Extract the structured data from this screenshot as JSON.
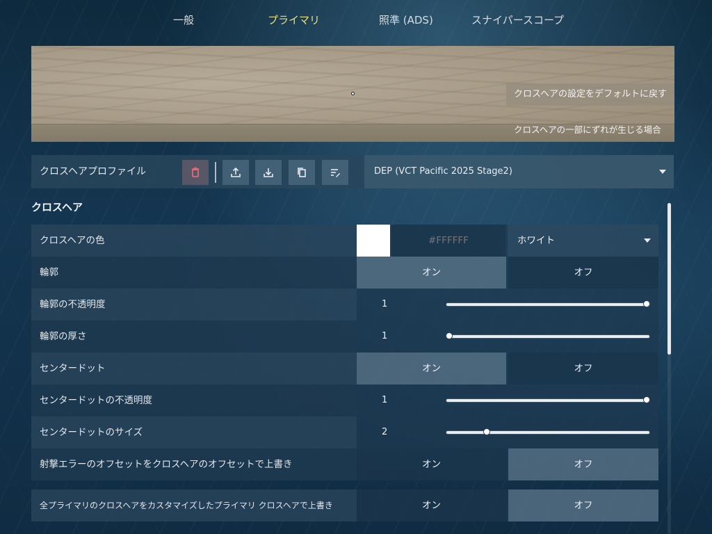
{
  "tabs": [
    {
      "label": "一般",
      "active": false
    },
    {
      "label": "プライマリ",
      "active": true
    },
    {
      "label": "照準 (ADS)",
      "active": false
    },
    {
      "label": "スナイパースコープ",
      "active": false
    }
  ],
  "preview": {
    "reset_button": "クロスヘアの設定をデフォルトに戻す",
    "misalignment_link": "クロスヘアの一部にずれが生じる場合"
  },
  "profile": {
    "label": "クロスヘアプロファイル",
    "buttons": [
      "delete-icon",
      "export-icon",
      "import-icon",
      "copy-icon",
      "rename-icon"
    ],
    "selected": "DEP (VCT Pacific 2025 Stage2)"
  },
  "section": {
    "title": "クロスヘア"
  },
  "settings": {
    "color": {
      "label": "クロスヘアの色",
      "hex_placeholder": "#FFFFFF",
      "swatch": "#FFFFFF",
      "selected": "ホワイト"
    },
    "outline": {
      "label": "輪郭",
      "on": "オン",
      "off": "オフ",
      "value": "on"
    },
    "outline_opacity": {
      "label": "輪郭の不透明度",
      "value": "1",
      "fraction": 1.0
    },
    "outline_thickness": {
      "label": "輪郭の厚さ",
      "value": "1",
      "fraction": 0.0
    },
    "center_dot": {
      "label": "センタードット",
      "on": "オン",
      "off": "オフ",
      "value": "on"
    },
    "center_dot_opacity": {
      "label": "センタードットの不透明度",
      "value": "1",
      "fraction": 1.0
    },
    "center_dot_size": {
      "label": "センタードットのサイズ",
      "value": "2",
      "fraction": 0.2
    },
    "firing_error_override": {
      "label": "射撃エラーのオフセットをクロスヘアのオフセットで上書き",
      "on": "オン",
      "off": "オフ",
      "value": "off"
    },
    "all_primary_override": {
      "label": "全プライマリのクロスヘアをカスタマイズしたプライマリ クロスヘアで上書き",
      "on": "オン",
      "off": "オフ",
      "value": "off"
    }
  },
  "colors": {
    "active_tab": "#E9E07A",
    "delete_icon": "#E8707A"
  }
}
